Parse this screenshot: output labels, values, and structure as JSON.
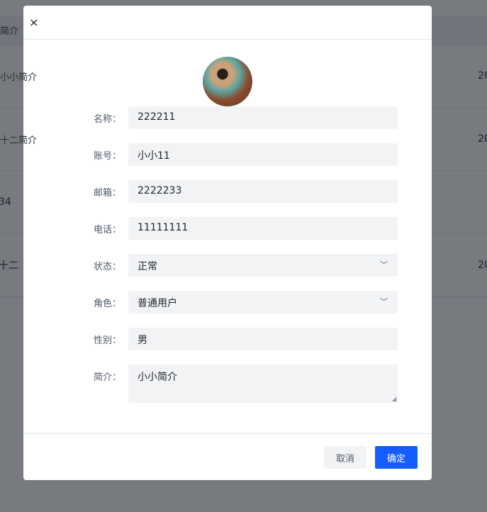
{
  "background_table": {
    "header": "简介",
    "rows": [
      {
        "intro": "小小简介",
        "date": "20"
      },
      {
        "intro": "十二简介",
        "date": "20"
      },
      {
        "intro": "34",
        "date": ""
      },
      {
        "intro": "十二",
        "date": "20"
      }
    ]
  },
  "modal": {
    "close_icon": "×",
    "fields": [
      {
        "label": "名称：",
        "value": "222211"
      },
      {
        "label": "账号：",
        "value": "小小11"
      },
      {
        "label": "邮箱：",
        "value": "2222233"
      },
      {
        "label": "电话：",
        "value": "11111111"
      },
      {
        "label": "状态：",
        "value": "正常"
      },
      {
        "label": "角色：",
        "value": "普通用户"
      },
      {
        "label": "性别：",
        "value": "男"
      },
      {
        "label": "简介：",
        "value": "小小简介"
      }
    ],
    "cancel": "取消",
    "ok": "确定"
  },
  "colors": {
    "primary": "#165dff",
    "input_bg": "#f2f3f5"
  }
}
